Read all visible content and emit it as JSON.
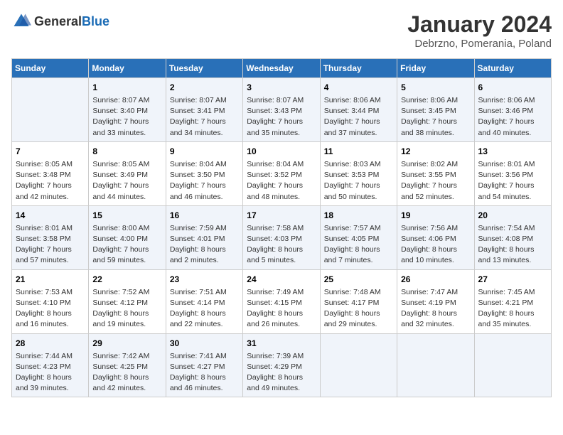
{
  "header": {
    "logo_general": "General",
    "logo_blue": "Blue",
    "main_title": "January 2024",
    "sub_title": "Debrzno, Pomerania, Poland"
  },
  "weekdays": [
    "Sunday",
    "Monday",
    "Tuesday",
    "Wednesday",
    "Thursday",
    "Friday",
    "Saturday"
  ],
  "weeks": [
    [
      {
        "day": "",
        "details": ""
      },
      {
        "day": "1",
        "details": "Sunrise: 8:07 AM\nSunset: 3:40 PM\nDaylight: 7 hours\nand 33 minutes."
      },
      {
        "day": "2",
        "details": "Sunrise: 8:07 AM\nSunset: 3:41 PM\nDaylight: 7 hours\nand 34 minutes."
      },
      {
        "day": "3",
        "details": "Sunrise: 8:07 AM\nSunset: 3:43 PM\nDaylight: 7 hours\nand 35 minutes."
      },
      {
        "day": "4",
        "details": "Sunrise: 8:06 AM\nSunset: 3:44 PM\nDaylight: 7 hours\nand 37 minutes."
      },
      {
        "day": "5",
        "details": "Sunrise: 8:06 AM\nSunset: 3:45 PM\nDaylight: 7 hours\nand 38 minutes."
      },
      {
        "day": "6",
        "details": "Sunrise: 8:06 AM\nSunset: 3:46 PM\nDaylight: 7 hours\nand 40 minutes."
      }
    ],
    [
      {
        "day": "7",
        "details": "Sunrise: 8:05 AM\nSunset: 3:48 PM\nDaylight: 7 hours\nand 42 minutes."
      },
      {
        "day": "8",
        "details": "Sunrise: 8:05 AM\nSunset: 3:49 PM\nDaylight: 7 hours\nand 44 minutes."
      },
      {
        "day": "9",
        "details": "Sunrise: 8:04 AM\nSunset: 3:50 PM\nDaylight: 7 hours\nand 46 minutes."
      },
      {
        "day": "10",
        "details": "Sunrise: 8:04 AM\nSunset: 3:52 PM\nDaylight: 7 hours\nand 48 minutes."
      },
      {
        "day": "11",
        "details": "Sunrise: 8:03 AM\nSunset: 3:53 PM\nDaylight: 7 hours\nand 50 minutes."
      },
      {
        "day": "12",
        "details": "Sunrise: 8:02 AM\nSunset: 3:55 PM\nDaylight: 7 hours\nand 52 minutes."
      },
      {
        "day": "13",
        "details": "Sunrise: 8:01 AM\nSunset: 3:56 PM\nDaylight: 7 hours\nand 54 minutes."
      }
    ],
    [
      {
        "day": "14",
        "details": "Sunrise: 8:01 AM\nSunset: 3:58 PM\nDaylight: 7 hours\nand 57 minutes."
      },
      {
        "day": "15",
        "details": "Sunrise: 8:00 AM\nSunset: 4:00 PM\nDaylight: 7 hours\nand 59 minutes."
      },
      {
        "day": "16",
        "details": "Sunrise: 7:59 AM\nSunset: 4:01 PM\nDaylight: 8 hours\nand 2 minutes."
      },
      {
        "day": "17",
        "details": "Sunrise: 7:58 AM\nSunset: 4:03 PM\nDaylight: 8 hours\nand 5 minutes."
      },
      {
        "day": "18",
        "details": "Sunrise: 7:57 AM\nSunset: 4:05 PM\nDaylight: 8 hours\nand 7 minutes."
      },
      {
        "day": "19",
        "details": "Sunrise: 7:56 AM\nSunset: 4:06 PM\nDaylight: 8 hours\nand 10 minutes."
      },
      {
        "day": "20",
        "details": "Sunrise: 7:54 AM\nSunset: 4:08 PM\nDaylight: 8 hours\nand 13 minutes."
      }
    ],
    [
      {
        "day": "21",
        "details": "Sunrise: 7:53 AM\nSunset: 4:10 PM\nDaylight: 8 hours\nand 16 minutes."
      },
      {
        "day": "22",
        "details": "Sunrise: 7:52 AM\nSunset: 4:12 PM\nDaylight: 8 hours\nand 19 minutes."
      },
      {
        "day": "23",
        "details": "Sunrise: 7:51 AM\nSunset: 4:14 PM\nDaylight: 8 hours\nand 22 minutes."
      },
      {
        "day": "24",
        "details": "Sunrise: 7:49 AM\nSunset: 4:15 PM\nDaylight: 8 hours\nand 26 minutes."
      },
      {
        "day": "25",
        "details": "Sunrise: 7:48 AM\nSunset: 4:17 PM\nDaylight: 8 hours\nand 29 minutes."
      },
      {
        "day": "26",
        "details": "Sunrise: 7:47 AM\nSunset: 4:19 PM\nDaylight: 8 hours\nand 32 minutes."
      },
      {
        "day": "27",
        "details": "Sunrise: 7:45 AM\nSunset: 4:21 PM\nDaylight: 8 hours\nand 35 minutes."
      }
    ],
    [
      {
        "day": "28",
        "details": "Sunrise: 7:44 AM\nSunset: 4:23 PM\nDaylight: 8 hours\nand 39 minutes."
      },
      {
        "day": "29",
        "details": "Sunrise: 7:42 AM\nSunset: 4:25 PM\nDaylight: 8 hours\nand 42 minutes."
      },
      {
        "day": "30",
        "details": "Sunrise: 7:41 AM\nSunset: 4:27 PM\nDaylight: 8 hours\nand 46 minutes."
      },
      {
        "day": "31",
        "details": "Sunrise: 7:39 AM\nSunset: 4:29 PM\nDaylight: 8 hours\nand 49 minutes."
      },
      {
        "day": "",
        "details": ""
      },
      {
        "day": "",
        "details": ""
      },
      {
        "day": "",
        "details": ""
      }
    ]
  ]
}
